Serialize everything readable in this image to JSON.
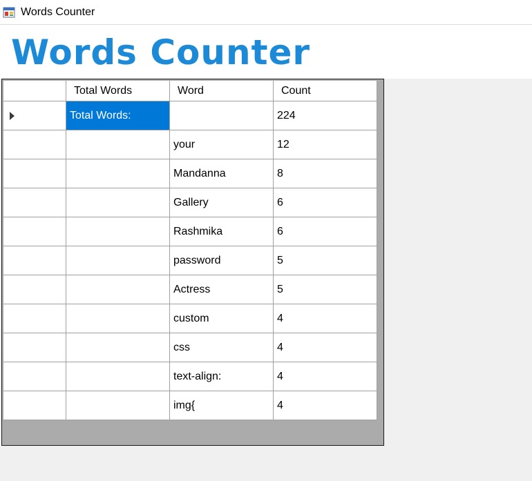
{
  "window": {
    "title": "Words Counter",
    "icon": "winforms-app-icon"
  },
  "header": {
    "heading": "Words Counter",
    "heading_color": "#1d8ad8"
  },
  "grid": {
    "columns": [
      "",
      "Total Words",
      "Word",
      "Count"
    ],
    "rows": [
      {
        "total": "Total Words:",
        "word": "",
        "count": "224",
        "selected": true
      },
      {
        "total": "",
        "word": "your",
        "count": "12"
      },
      {
        "total": "",
        "word": "Mandanna",
        "count": "8"
      },
      {
        "total": "",
        "word": "Gallery",
        "count": "6"
      },
      {
        "total": "",
        "word": "Rashmika",
        "count": "6"
      },
      {
        "total": "",
        "word": "password",
        "count": "5"
      },
      {
        "total": "",
        "word": "Actress",
        "count": "5"
      },
      {
        "total": "",
        "word": "custom",
        "count": "4"
      },
      {
        "total": "",
        "word": "css",
        "count": "4"
      },
      {
        "total": "",
        "word": "text-align:",
        "count": "4"
      },
      {
        "total": "",
        "word": "img{",
        "count": "4"
      }
    ],
    "selection_color": "#0078d7"
  }
}
